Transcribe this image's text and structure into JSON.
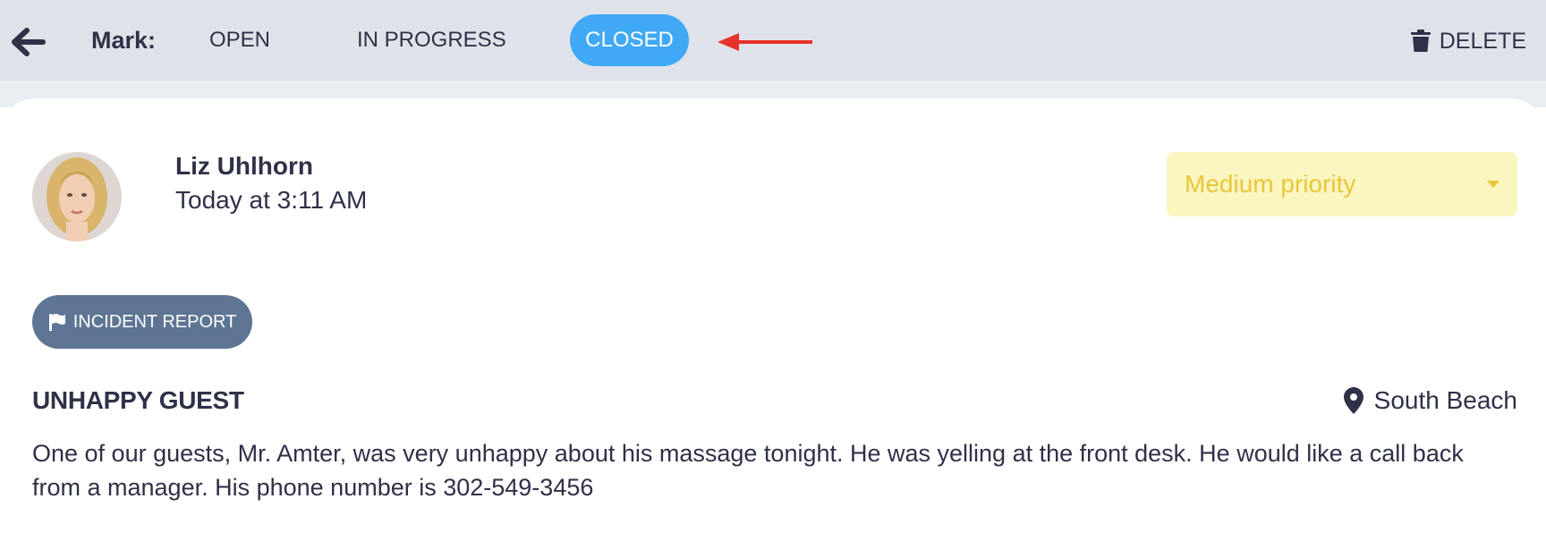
{
  "toolbar": {
    "back_icon": "arrow-left-icon",
    "mark_label": "Mark:",
    "statuses": [
      {
        "label": "OPEN",
        "selected": false
      },
      {
        "label": "IN PROGRESS",
        "selected": false
      },
      {
        "label": "CLOSED",
        "selected": true
      }
    ],
    "delete_label": "DELETE",
    "delete_icon": "trash-icon",
    "accent_color": "#3fa9f5",
    "annotation_color": "#e8312b"
  },
  "report": {
    "author": "Liz Uhlhorn",
    "time": "Today at 3:11 AM",
    "priority": "Medium priority",
    "priority_color": "#e8c73a",
    "tag_label": "INCIDENT REPORT",
    "tag_icon": "flag-icon",
    "title": "UNHAPPY GUEST",
    "location": "South Beach",
    "location_icon": "map-pin-icon",
    "body": "One of our guests, Mr. Amter, was very unhappy about his massage tonight. He was yelling at the front desk. He would like a call back from a manager. His phone number is 302-549-3456"
  }
}
